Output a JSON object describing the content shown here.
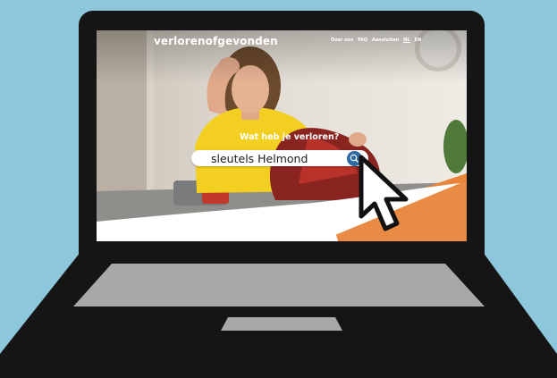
{
  "site": {
    "logo_text": "verlorenofgevonden",
    "nav": [
      {
        "label": "Over ons"
      },
      {
        "label": "FAQ"
      },
      {
        "label": "Aansluiten"
      },
      {
        "label": "NL",
        "active": true
      },
      {
        "label": "EN"
      }
    ]
  },
  "hero": {
    "title": "Wat heb je verloren?",
    "search_value": "sleutels Helmond"
  },
  "icons": {
    "search_button": "search-icon",
    "cursor": "mouse-pointer-icon"
  },
  "colors": {
    "background": "#8cc7dc",
    "laptop": "#151515",
    "keyboard": "#a7a9a9",
    "accent_orange": "#e8853a",
    "search_button": "#2e6aa5"
  }
}
